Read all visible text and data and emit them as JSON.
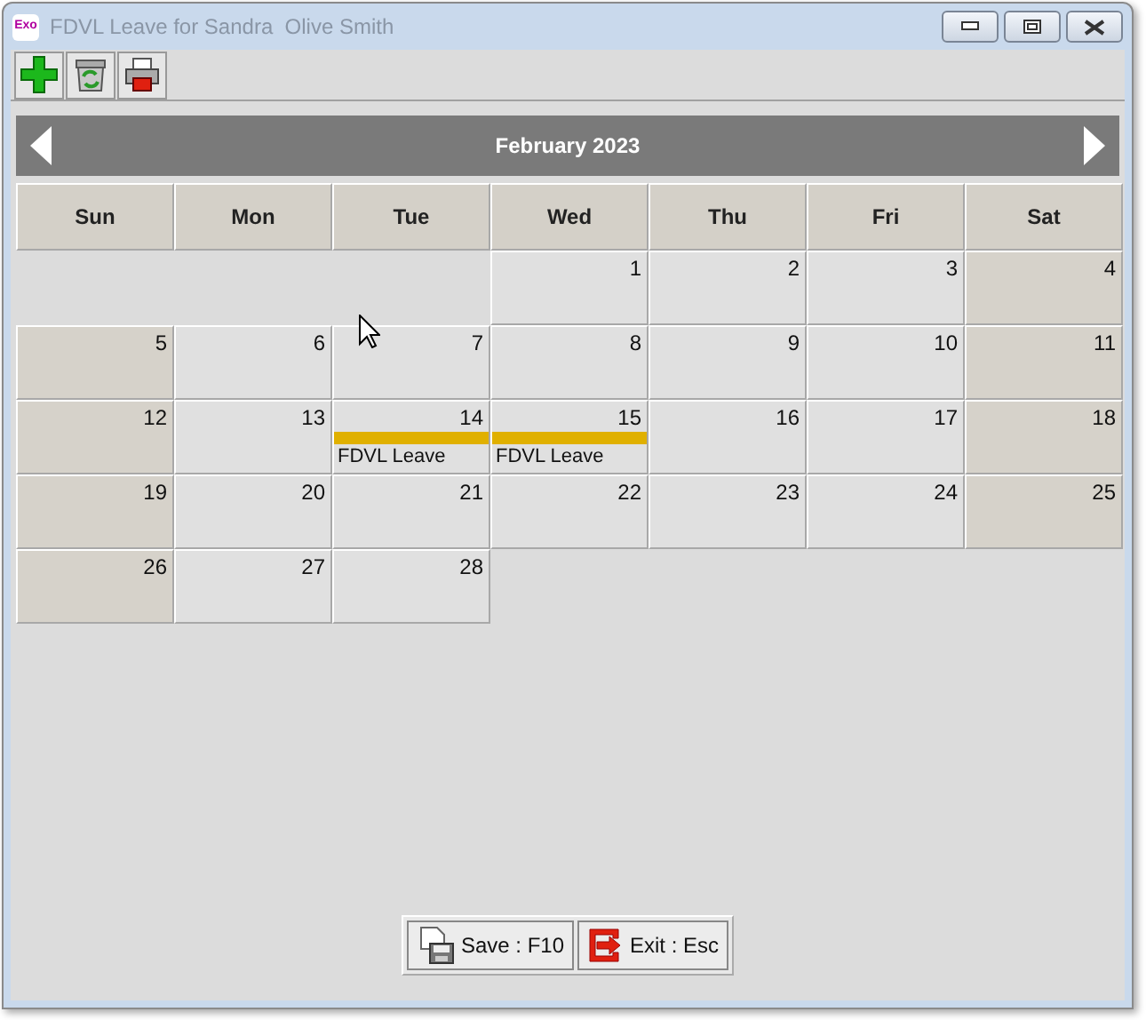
{
  "window": {
    "app_badge": "Exo",
    "title": "FDVL Leave for Sandra  Olive Smith"
  },
  "calendar": {
    "title": "February 2023",
    "day_names": [
      "Sun",
      "Mon",
      "Tue",
      "Wed",
      "Thu",
      "Fri",
      "Sat"
    ],
    "weeks": [
      [
        {
          "kind": "blank"
        },
        {
          "kind": "blank"
        },
        {
          "kind": "blank"
        },
        {
          "kind": "day",
          "day": "1",
          "weekend": false
        },
        {
          "kind": "day",
          "day": "2",
          "weekend": false
        },
        {
          "kind": "day",
          "day": "3",
          "weekend": false
        },
        {
          "kind": "day",
          "day": "4",
          "weekend": true
        }
      ],
      [
        {
          "kind": "day",
          "day": "5",
          "weekend": true
        },
        {
          "kind": "day",
          "day": "6",
          "weekend": false
        },
        {
          "kind": "day",
          "day": "7",
          "weekend": false
        },
        {
          "kind": "day",
          "day": "8",
          "weekend": false
        },
        {
          "kind": "day",
          "day": "9",
          "weekend": false
        },
        {
          "kind": "day",
          "day": "10",
          "weekend": false
        },
        {
          "kind": "day",
          "day": "11",
          "weekend": true
        }
      ],
      [
        {
          "kind": "day",
          "day": "12",
          "weekend": true
        },
        {
          "kind": "day",
          "day": "13",
          "weekend": false
        },
        {
          "kind": "day",
          "day": "14",
          "weekend": false,
          "events": [
            {
              "label": "FDVL Leave",
              "color": "#e0b000"
            }
          ]
        },
        {
          "kind": "day",
          "day": "15",
          "weekend": false,
          "events": [
            {
              "label": "FDVL Leave",
              "color": "#e0b000"
            }
          ]
        },
        {
          "kind": "day",
          "day": "16",
          "weekend": false
        },
        {
          "kind": "day",
          "day": "17",
          "weekend": false
        },
        {
          "kind": "day",
          "day": "18",
          "weekend": true
        }
      ],
      [
        {
          "kind": "day",
          "day": "19",
          "weekend": true
        },
        {
          "kind": "day",
          "day": "20",
          "weekend": false
        },
        {
          "kind": "day",
          "day": "21",
          "weekend": false
        },
        {
          "kind": "day",
          "day": "22",
          "weekend": false
        },
        {
          "kind": "day",
          "day": "23",
          "weekend": false
        },
        {
          "kind": "day",
          "day": "24",
          "weekend": false
        },
        {
          "kind": "day",
          "day": "25",
          "weekend": true
        }
      ],
      [
        {
          "kind": "day",
          "day": "26",
          "weekend": true
        },
        {
          "kind": "day",
          "day": "27",
          "weekend": false
        },
        {
          "kind": "day",
          "day": "28",
          "weekend": false
        },
        {
          "kind": "blank"
        },
        {
          "kind": "blank"
        },
        {
          "kind": "blank"
        },
        {
          "kind": "blank"
        }
      ]
    ]
  },
  "buttons": [
    {
      "kind": "save",
      "label": "Save : F10"
    },
    {
      "kind": "exit",
      "label": "Exit : Esc"
    }
  ]
}
